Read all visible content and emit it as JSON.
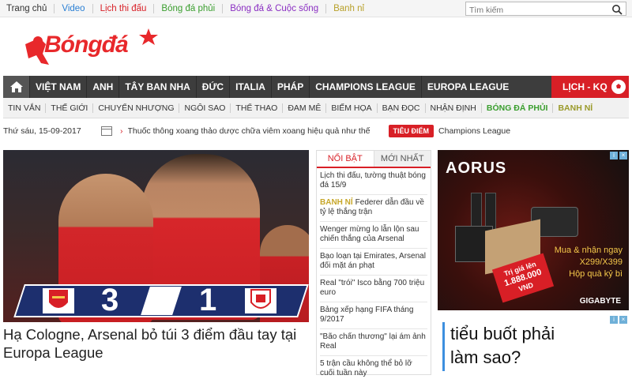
{
  "toplinks": [
    {
      "label": "Trang chủ",
      "color": "#333333"
    },
    {
      "label": "Video",
      "color": "#2a7fd4"
    },
    {
      "label": "Lịch thi đấu",
      "color": "#d81f26"
    },
    {
      "label": "Bóng đá phủi",
      "color": "#3a9e2e"
    },
    {
      "label": "Bóng đá & Cuộc sống",
      "color": "#8a2ec2"
    },
    {
      "label": "Banh nỉ",
      "color": "#b8a12a"
    }
  ],
  "search": {
    "placeholder": "Tìm kiếm"
  },
  "logo": {
    "text": "Bóngđá"
  },
  "mainnav": {
    "items": [
      "VIỆT NAM",
      "ANH",
      "TÂY BAN NHA",
      "ĐỨC",
      "ITALIA",
      "PHÁP",
      "CHAMPIONS LEAGUE",
      "EUROPA LEAGUE"
    ],
    "right_label": "LỊCH - KQ"
  },
  "subnav": {
    "items": [
      "TIN VẮN",
      "THẾ GIỚI",
      "CHUYỂN NHƯỢNG",
      "NGÔI SAO",
      "THỂ THAO",
      "ĐAM MÊ",
      "BIẾM HỌA",
      "BẠN ĐỌC",
      "NHẬN ĐỊNH",
      "BÓNG ĐÁ PHỦI",
      "BANH NỈ"
    ]
  },
  "ticker": {
    "date": "Thứ sáu, 15-09-2017",
    "text": "Thuốc thông xoang thảo dược chữa viêm xoang hiệu quả như thế",
    "badge": "TIÊU ĐIỂM",
    "topic": "Champions League"
  },
  "hero": {
    "score_home": "3",
    "score_away": "1",
    "headline": "Hạ Cologne, Arsenal bỏ túi 3 điểm đầu tay tại Europa League"
  },
  "news": {
    "tab_active": "NỔI BẬT",
    "tab_inactive": "MỚI NHẤT",
    "items": [
      {
        "tag": "",
        "text": "Lịch thi đấu, tường thuật bóng đá 15/9"
      },
      {
        "tag": "BANH NỈ",
        "text": "Federer dẫn đầu về tỷ lệ thắng trận"
      },
      {
        "tag": "",
        "text": "Wenger mừng lo lẫn lộn sau chiến thắng của Arsenal"
      },
      {
        "tag": "",
        "text": "Bạo loạn tại Emirates, Arsenal đối mặt án phạt"
      },
      {
        "tag": "",
        "text": "Real \"trói\" Isco bằng 700 triệu euro"
      },
      {
        "tag": "",
        "text": "Bảng xếp hạng FIFA tháng 9/2017"
      },
      {
        "tag": "",
        "text": "\"Bão chấn thương\" lại ám ảnh Real"
      },
      {
        "tag": "",
        "text": "5 trận cầu không thể bỏ lỡ cuối tuần này"
      }
    ]
  },
  "ad1": {
    "brand": "AORUS",
    "promo_line1": "Mua & nhận ngay",
    "promo_line2": "X299/X399",
    "promo_line3": "Hộp quà kỷ bì",
    "prize_line1": "Trị giá lên",
    "prize_line2": "1.888.000",
    "prize_line3": "VND",
    "maker": "GIGABYTE"
  },
  "ad2": {
    "line1": "tiểu buốt phải",
    "line2": "làm sao?"
  },
  "colors": {
    "accent": "#d81f26",
    "nav": "#3d3d3d"
  }
}
